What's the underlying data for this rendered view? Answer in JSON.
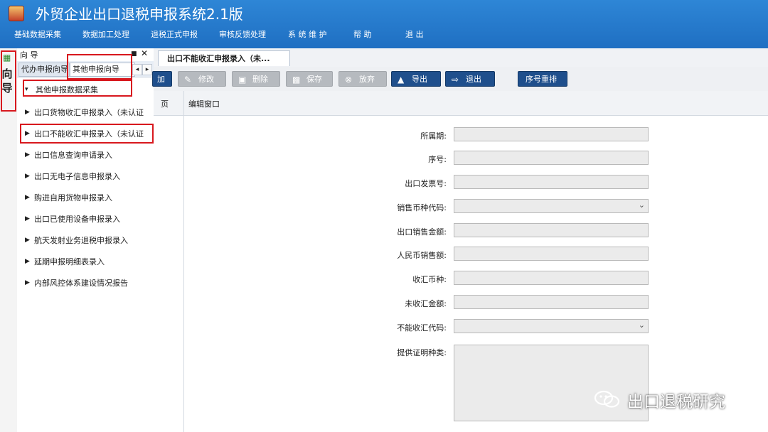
{
  "app": {
    "title": "外贸企业出口退税申报系统2.1版"
  },
  "menu": [
    "基础数据采集",
    "数据加工处理",
    "退税正式申报",
    "审核反馈处理",
    "系 统 维 护",
    "帮 助",
    "退 出"
  ],
  "sidebar_tab": {
    "label": "向导"
  },
  "guide": {
    "title": "向 导",
    "tabs": [
      "代办申报向导",
      "其他申报向导"
    ],
    "group": "其他申报数据采集",
    "items": [
      "出口货物收汇申报录入（未认证",
      "出口不能收汇申报录入（未认证",
      "出口信息查询申请录入",
      "出口无电子信息申报录入",
      "购进自用货物申报录入",
      "出口已使用设备申报录入",
      "航天发射业务退税申报录入",
      "延期申报明细表录入",
      "内部风控体系建设情况报告"
    ]
  },
  "doc_tab": {
    "label": "出口不能收汇申报录入（未..."
  },
  "toolbar": {
    "add": "加",
    "edit": "修改",
    "delete": "删除",
    "save": "保存",
    "discard": "放弃",
    "export": "导出",
    "exit": "退出",
    "reorder": "序号重排"
  },
  "page_col": {
    "label": "页"
  },
  "edit_window": {
    "title": "编辑窗口"
  },
  "form": {
    "period": "所属期:",
    "seq": "序号:",
    "invoice": "出口发票号:",
    "currency_code": "销售币种代码:",
    "export_amount": "出口销售金额:",
    "rmb_amount": "人民币销售额:",
    "recv_currency": "收汇币种:",
    "unrecv_amount": "未收汇金额:",
    "cannot_code": "不能收汇代码:",
    "proof_type": "提供证明种类:"
  },
  "watermark": "出口退税研究",
  "colors": {
    "title_bar": "#2178cc",
    "highlight": "#d8181e",
    "button_active": "#1f4f8c"
  }
}
